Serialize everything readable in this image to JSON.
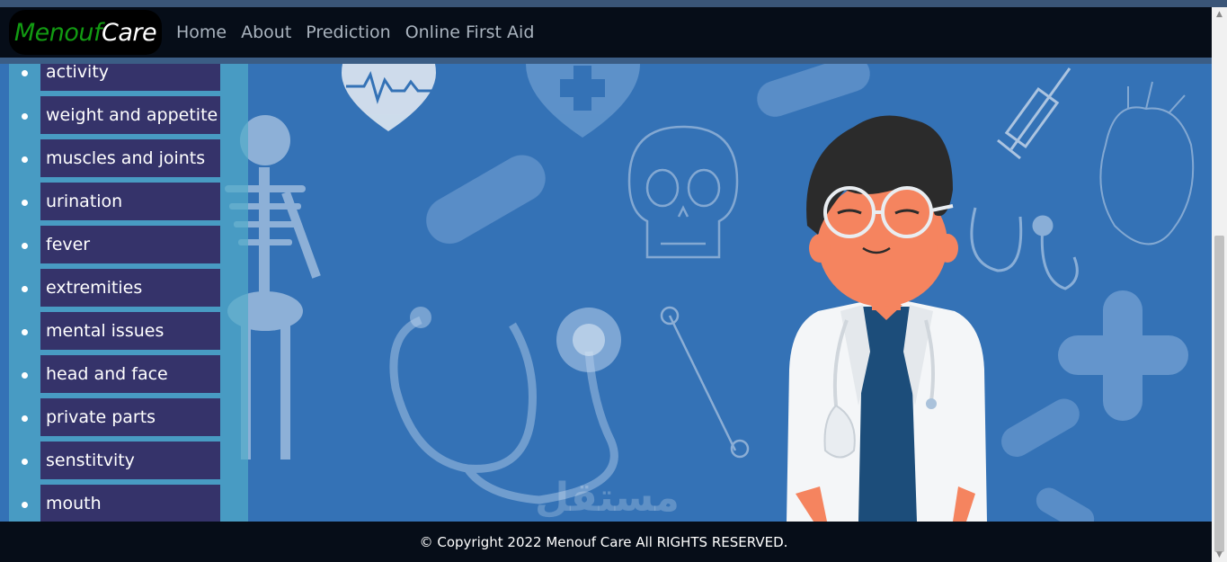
{
  "navbar": {
    "brand_part1": "Menouf",
    "brand_part2": "Care",
    "links": [
      "Home",
      "About",
      "Prediction",
      "Online First Aid"
    ]
  },
  "sidebar": {
    "items": [
      "activity",
      "weight and appetite",
      "muscles and joints",
      "urination",
      "fever",
      "extremities",
      "mental issues",
      "head and face",
      "private parts",
      "senstitvity",
      "mouth"
    ]
  },
  "footer": {
    "copyright": "© Copyright 2022 Menouf Care All RIGHTS RESERVED."
  },
  "watermark": "مستقل",
  "colors": {
    "navbar_bg": "#060d18",
    "hero_bg": "#3472b6",
    "sidebar_item_bg": "#35336a",
    "brand_green": "#129b12"
  }
}
